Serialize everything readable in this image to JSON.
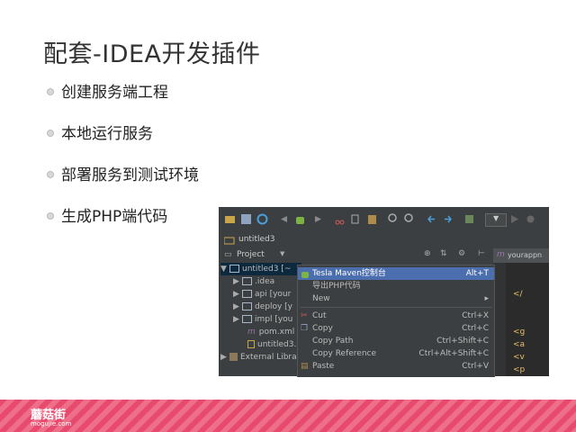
{
  "slide": {
    "title": "配套-IDEA开发插件",
    "bullets": [
      "创建服务端工程",
      "本地运行服务",
      "部署服务到测试环境",
      "生成PHP端代码"
    ]
  },
  "ide": {
    "crumb": "untitled3",
    "project_label": "Project",
    "editor_tab": "yourappn",
    "editor_lines": [
      "</",
      "<g",
      "<a",
      "<v",
      "<p"
    ],
    "tree": [
      {
        "label": "untitled3 [~",
        "depth": 0
      },
      {
        "label": ".idea",
        "depth": 1
      },
      {
        "label": "api [your",
        "depth": 1
      },
      {
        "label": "deploy [y",
        "depth": 1
      },
      {
        "label": "impl [you",
        "depth": 1
      },
      {
        "label": "pom.xml",
        "depth": 2
      },
      {
        "label": "untitled3.",
        "depth": 2
      },
      {
        "label": "External Libra",
        "depth": 0
      }
    ],
    "menu": [
      {
        "label": "Tesla Maven控制台",
        "shortcut": "Alt+T",
        "selected": true
      },
      {
        "label": "导出PHP代码",
        "shortcut": "",
        "selected": false
      },
      {
        "label": "New",
        "shortcut": "",
        "selected": false
      },
      {
        "label": "Cut",
        "shortcut": "Ctrl+X",
        "selected": false
      },
      {
        "label": "Copy",
        "shortcut": "Ctrl+C",
        "selected": false
      },
      {
        "label": "Copy Path",
        "shortcut": "Ctrl+Shift+C",
        "selected": false
      },
      {
        "label": "Copy Reference",
        "shortcut": "Ctrl+Alt+Shift+C",
        "selected": false
      },
      {
        "label": "Paste",
        "shortcut": "Ctrl+V",
        "selected": false
      }
    ]
  },
  "footer": {
    "brand_cn": "蘑菇街",
    "brand_en": "mogujie.com"
  }
}
